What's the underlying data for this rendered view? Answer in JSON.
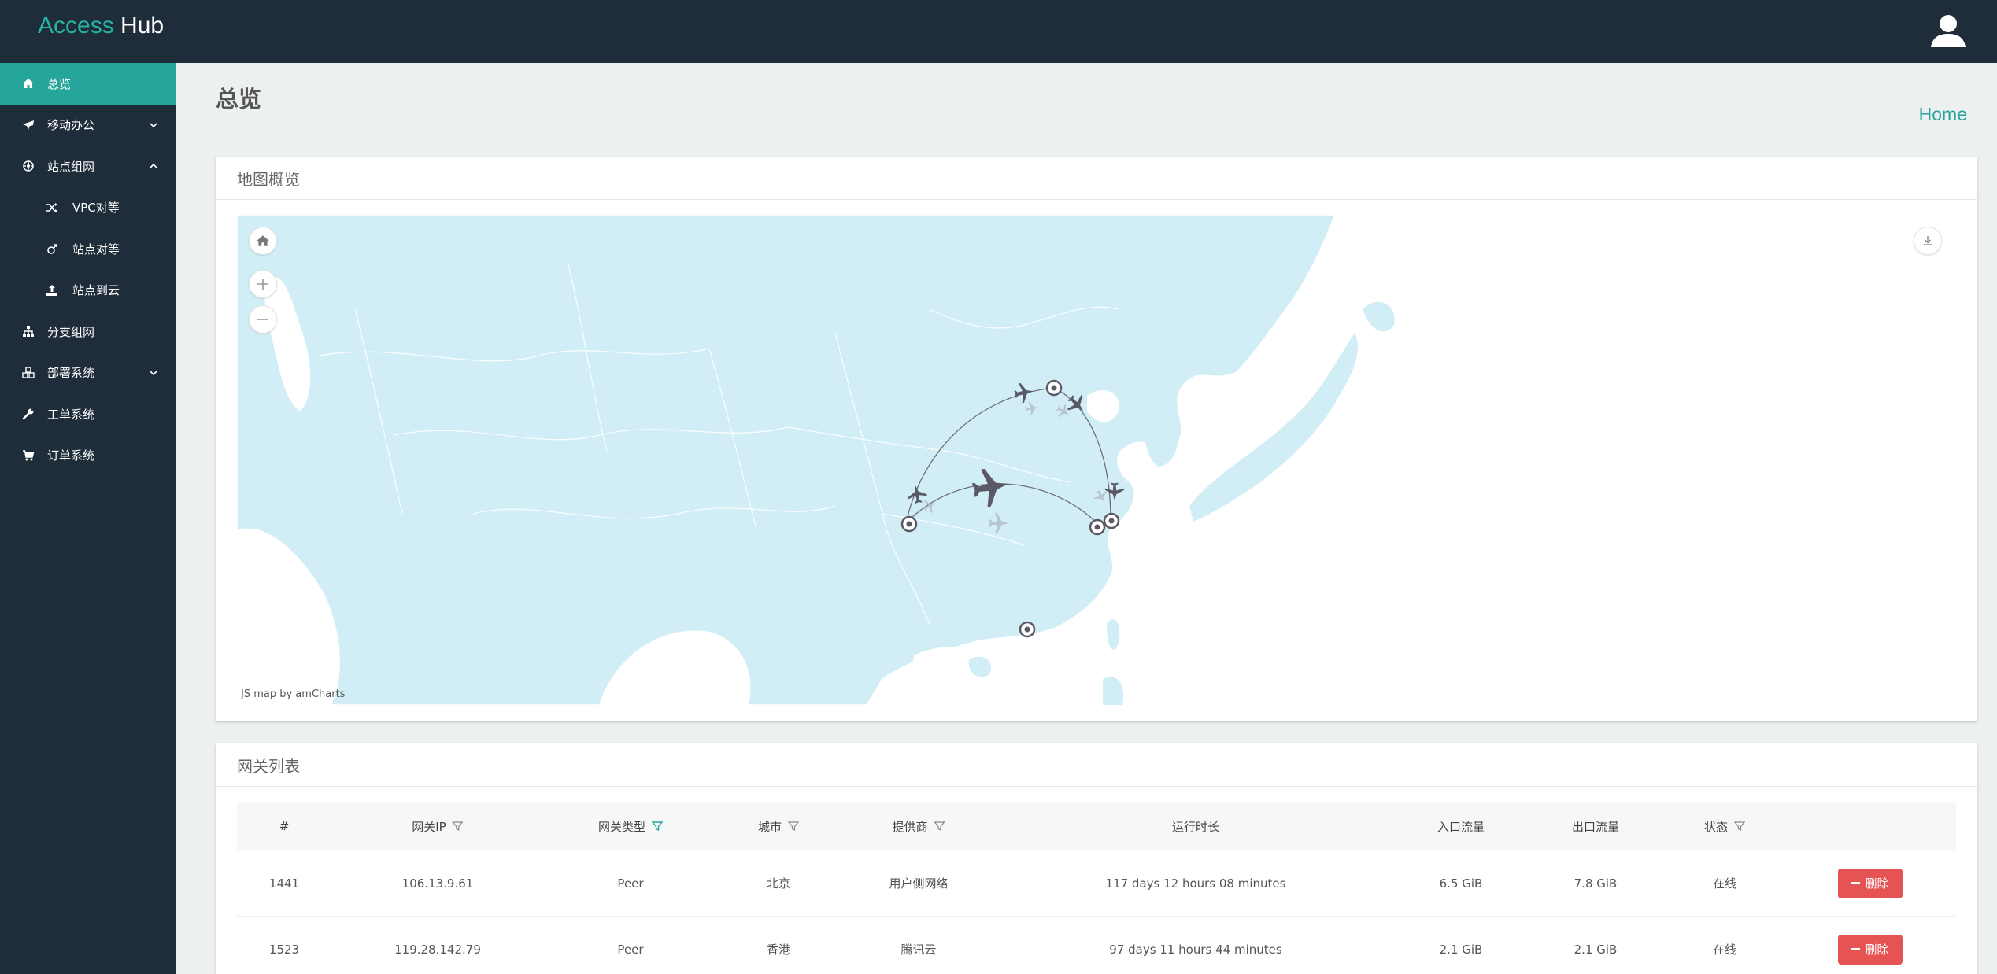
{
  "brand": {
    "part1": "Access",
    "part2": "Hub"
  },
  "header": {
    "user_icon": "user-icon"
  },
  "sidebar": {
    "items": [
      {
        "label": "总览",
        "icon": "home-icon",
        "active": true
      },
      {
        "label": "移动办公",
        "icon": "plane-icon",
        "chevron": "down"
      },
      {
        "label": "站点组网",
        "icon": "network-icon",
        "chevron": "up"
      },
      {
        "label": "VPC对等",
        "icon": "shuffle-icon",
        "sub": true
      },
      {
        "label": "站点对等",
        "icon": "peer-icon",
        "sub": true
      },
      {
        "label": "站点到云",
        "icon": "upload-icon",
        "sub": true
      },
      {
        "label": "分支组网",
        "icon": "sitemap-icon"
      },
      {
        "label": "部署系统",
        "icon": "cubes-icon",
        "chevron": "down"
      },
      {
        "label": "工单系统",
        "icon": "wrench-icon"
      },
      {
        "label": "订单系统",
        "icon": "cart-icon"
      }
    ]
  },
  "page": {
    "title": "总览",
    "breadcrumb": "Home"
  },
  "map_card": {
    "title": "地图概览",
    "credit": "JS map by amCharts",
    "controls": {
      "home": "home-icon",
      "zoom_in": "plus-icon",
      "zoom_out": "minus-icon",
      "export": "download-icon"
    }
  },
  "gateway_table": {
    "title": "网关列表",
    "columns": [
      {
        "label": "#",
        "filter": false
      },
      {
        "label": "网关IP",
        "filter": true
      },
      {
        "label": "网关类型",
        "filter": true,
        "filter_active": true
      },
      {
        "label": "城市",
        "filter": true
      },
      {
        "label": "提供商",
        "filter": true
      },
      {
        "label": "运行时长",
        "filter": false
      },
      {
        "label": "入口流量",
        "filter": false
      },
      {
        "label": "出口流量",
        "filter": false
      },
      {
        "label": "状态",
        "filter": true
      },
      {
        "label": "",
        "filter": false
      }
    ],
    "rows": [
      {
        "id": "1441",
        "ip": "106.13.9.61",
        "type": "Peer",
        "city": "北京",
        "provider": "用户侧网络",
        "uptime": "117 days 12 hours 08 minutes",
        "in": "6.5 GiB",
        "out": "7.8 GiB",
        "status": "在线",
        "action": "删除"
      },
      {
        "id": "1523",
        "ip": "119.28.142.79",
        "type": "Peer",
        "city": "香港",
        "provider": "腾讯云",
        "uptime": "97 days 11 hours 44 minutes",
        "in": "2.1 GiB",
        "out": "2.1 GiB",
        "status": "在线",
        "action": "删除"
      }
    ]
  },
  "colors": {
    "accent": "#26a69a",
    "sidebar_bg": "#1f2d3a",
    "danger": "#e55353",
    "map_land": "#d1eef7"
  }
}
